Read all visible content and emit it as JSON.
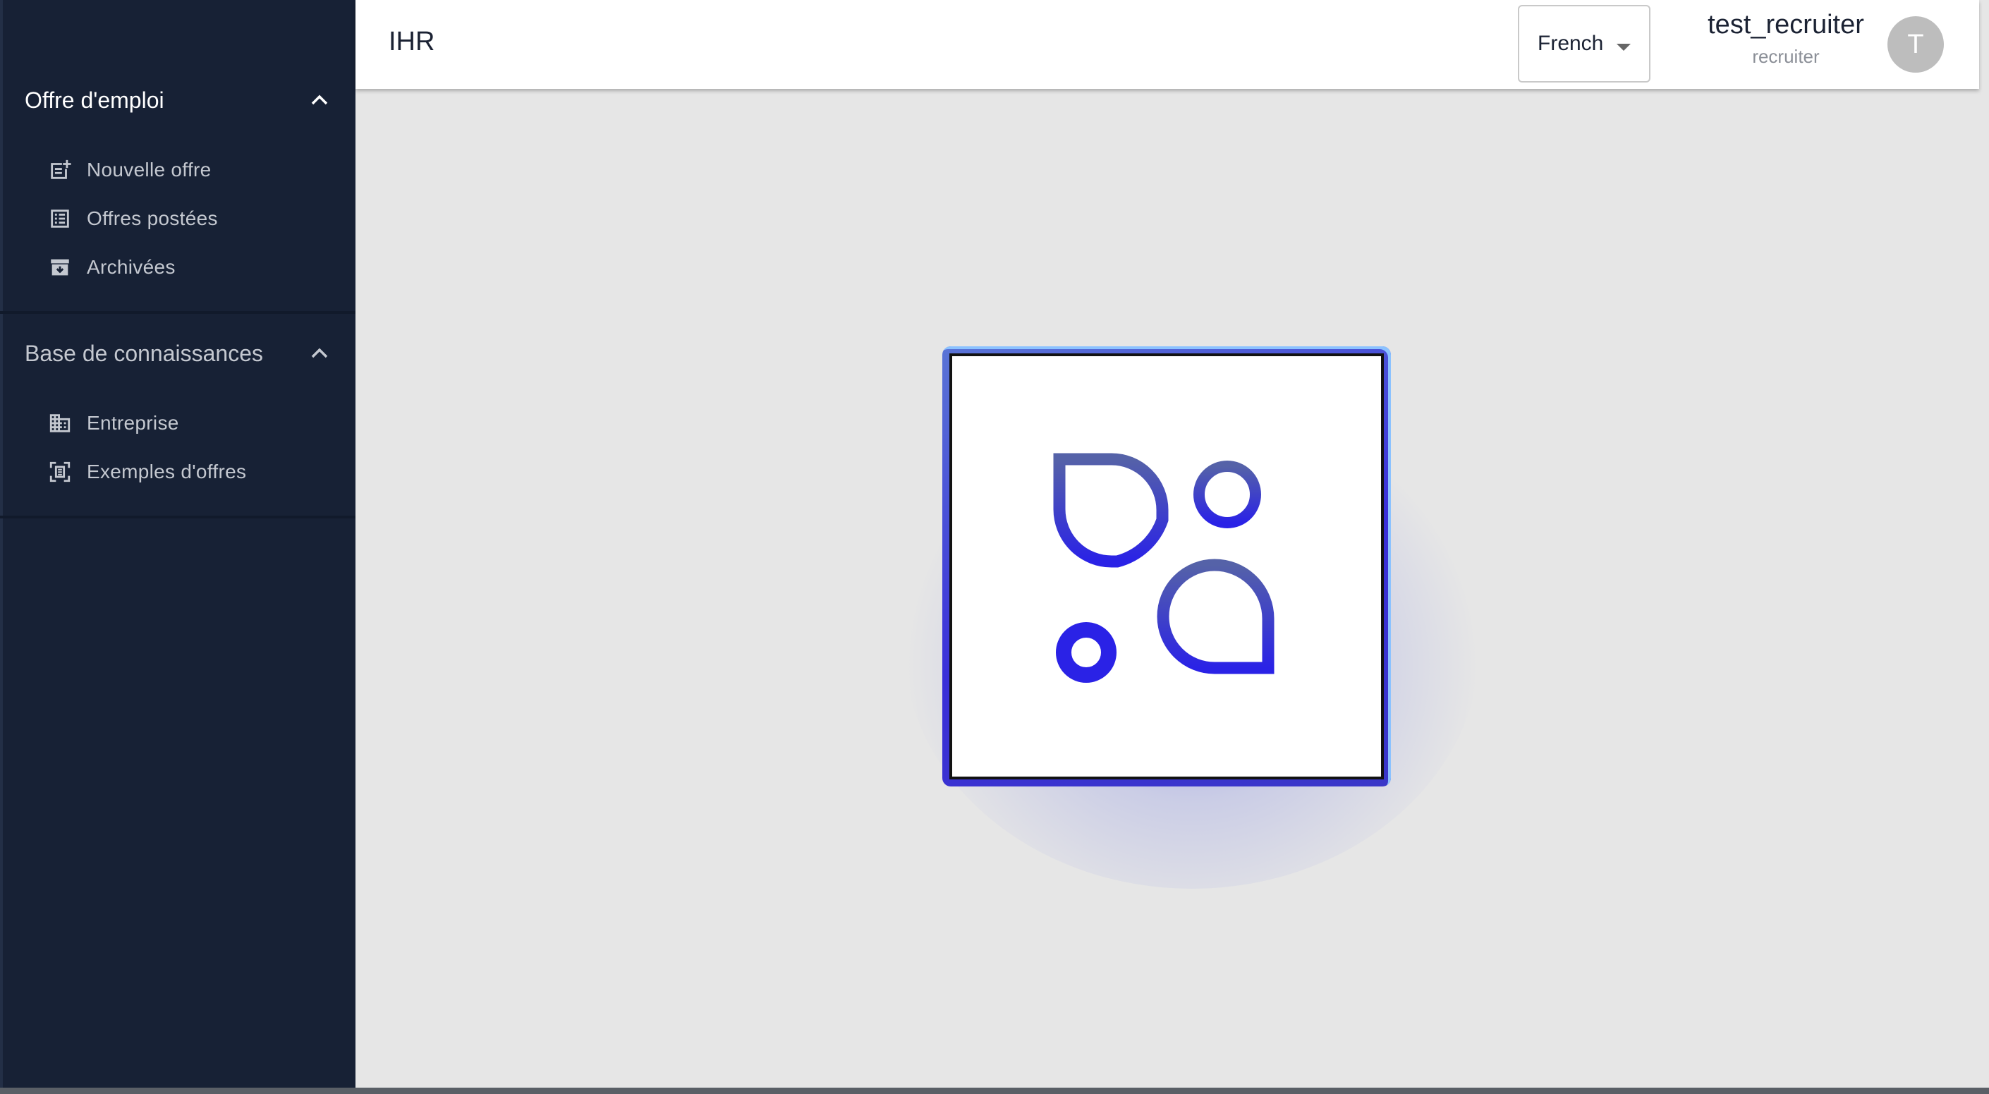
{
  "header": {
    "brand": "IHR",
    "language": "French",
    "user_name": "test_recruiter",
    "user_role": "recruiter",
    "avatar_initial": "T"
  },
  "sidebar": {
    "sections": [
      {
        "title": "Offre d'emploi",
        "expanded": true,
        "items": [
          {
            "label": "Nouvelle offre",
            "icon": "new-post-icon"
          },
          {
            "label": "Offres postées",
            "icon": "list-icon"
          },
          {
            "label": "Archivées",
            "icon": "archive-icon"
          }
        ]
      },
      {
        "title": "Base de connaissances",
        "expanded": true,
        "items": [
          {
            "label": "Entreprise",
            "icon": "building-icon"
          },
          {
            "label": "Exemples d'offres",
            "icon": "document-scan-icon"
          }
        ]
      }
    ]
  },
  "colors": {
    "sidebar_bg": "#172135",
    "content_bg": "#e6e6e6",
    "logo_accent": "#3a2fd8"
  }
}
